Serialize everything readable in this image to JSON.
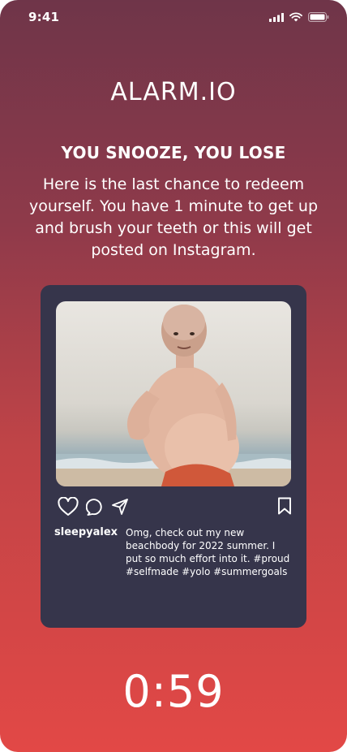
{
  "status_bar": {
    "time": "9:41",
    "icons": [
      "cellular-signal-icon",
      "wifi-icon",
      "battery-icon"
    ]
  },
  "app": {
    "title": "ALARM.IO",
    "headline": "YOU SNOOZE, YOU LOSE",
    "message": "Here is the last chance to redeem yourself. You have 1 minute to get up and brush your teeth or this will get posted on Instagram."
  },
  "post": {
    "image_alt": "beach photo",
    "actions": [
      "heart-icon",
      "comment-icon",
      "share-icon",
      "bookmark-icon"
    ],
    "username": "sleepyalex",
    "caption": "Omg, check out my new beachbody for 2022 summer. I put so much effort into it. #proud #selfmade #yolo #summergoals"
  },
  "timer": {
    "value": "0:59"
  },
  "colors": {
    "background_top": "#6f3549",
    "background_bottom": "#e24846",
    "card": "#36354b",
    "text": "#ffffff"
  }
}
